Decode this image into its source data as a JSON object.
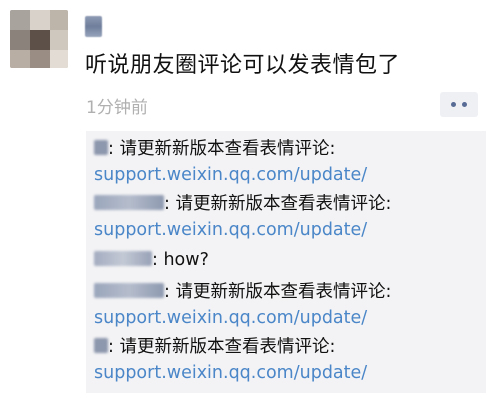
{
  "post": {
    "text": "听说朋友圈评论可以发表情包了",
    "timestamp": "1分钟前"
  },
  "comments": [
    {
      "separator": ":",
      "text": " 请更新新版本查看表情评论:",
      "link": "support.weixin.qq.com/update/"
    },
    {
      "separator": ":",
      "text": " 请更新新版本查看表情评论:",
      "link": "support.weixin.qq.com/update/"
    },
    {
      "separator": ":",
      "text": " how?"
    },
    {
      "separator": ":",
      "text": " 请更新新版本查看表情评论:",
      "link": "support.weixin.qq.com/update/"
    },
    {
      "separator": ":",
      "text": " 请更新新版本查看表情评论:",
      "link": "support.weixin.qq.com/update/"
    }
  ],
  "colors": {
    "link": "#4a86c8",
    "nickname": "#576b95",
    "comment_bg": "#f3f3f5",
    "timestamp": "#b0b0b0"
  },
  "icons": {
    "more": "more-dots-icon"
  }
}
